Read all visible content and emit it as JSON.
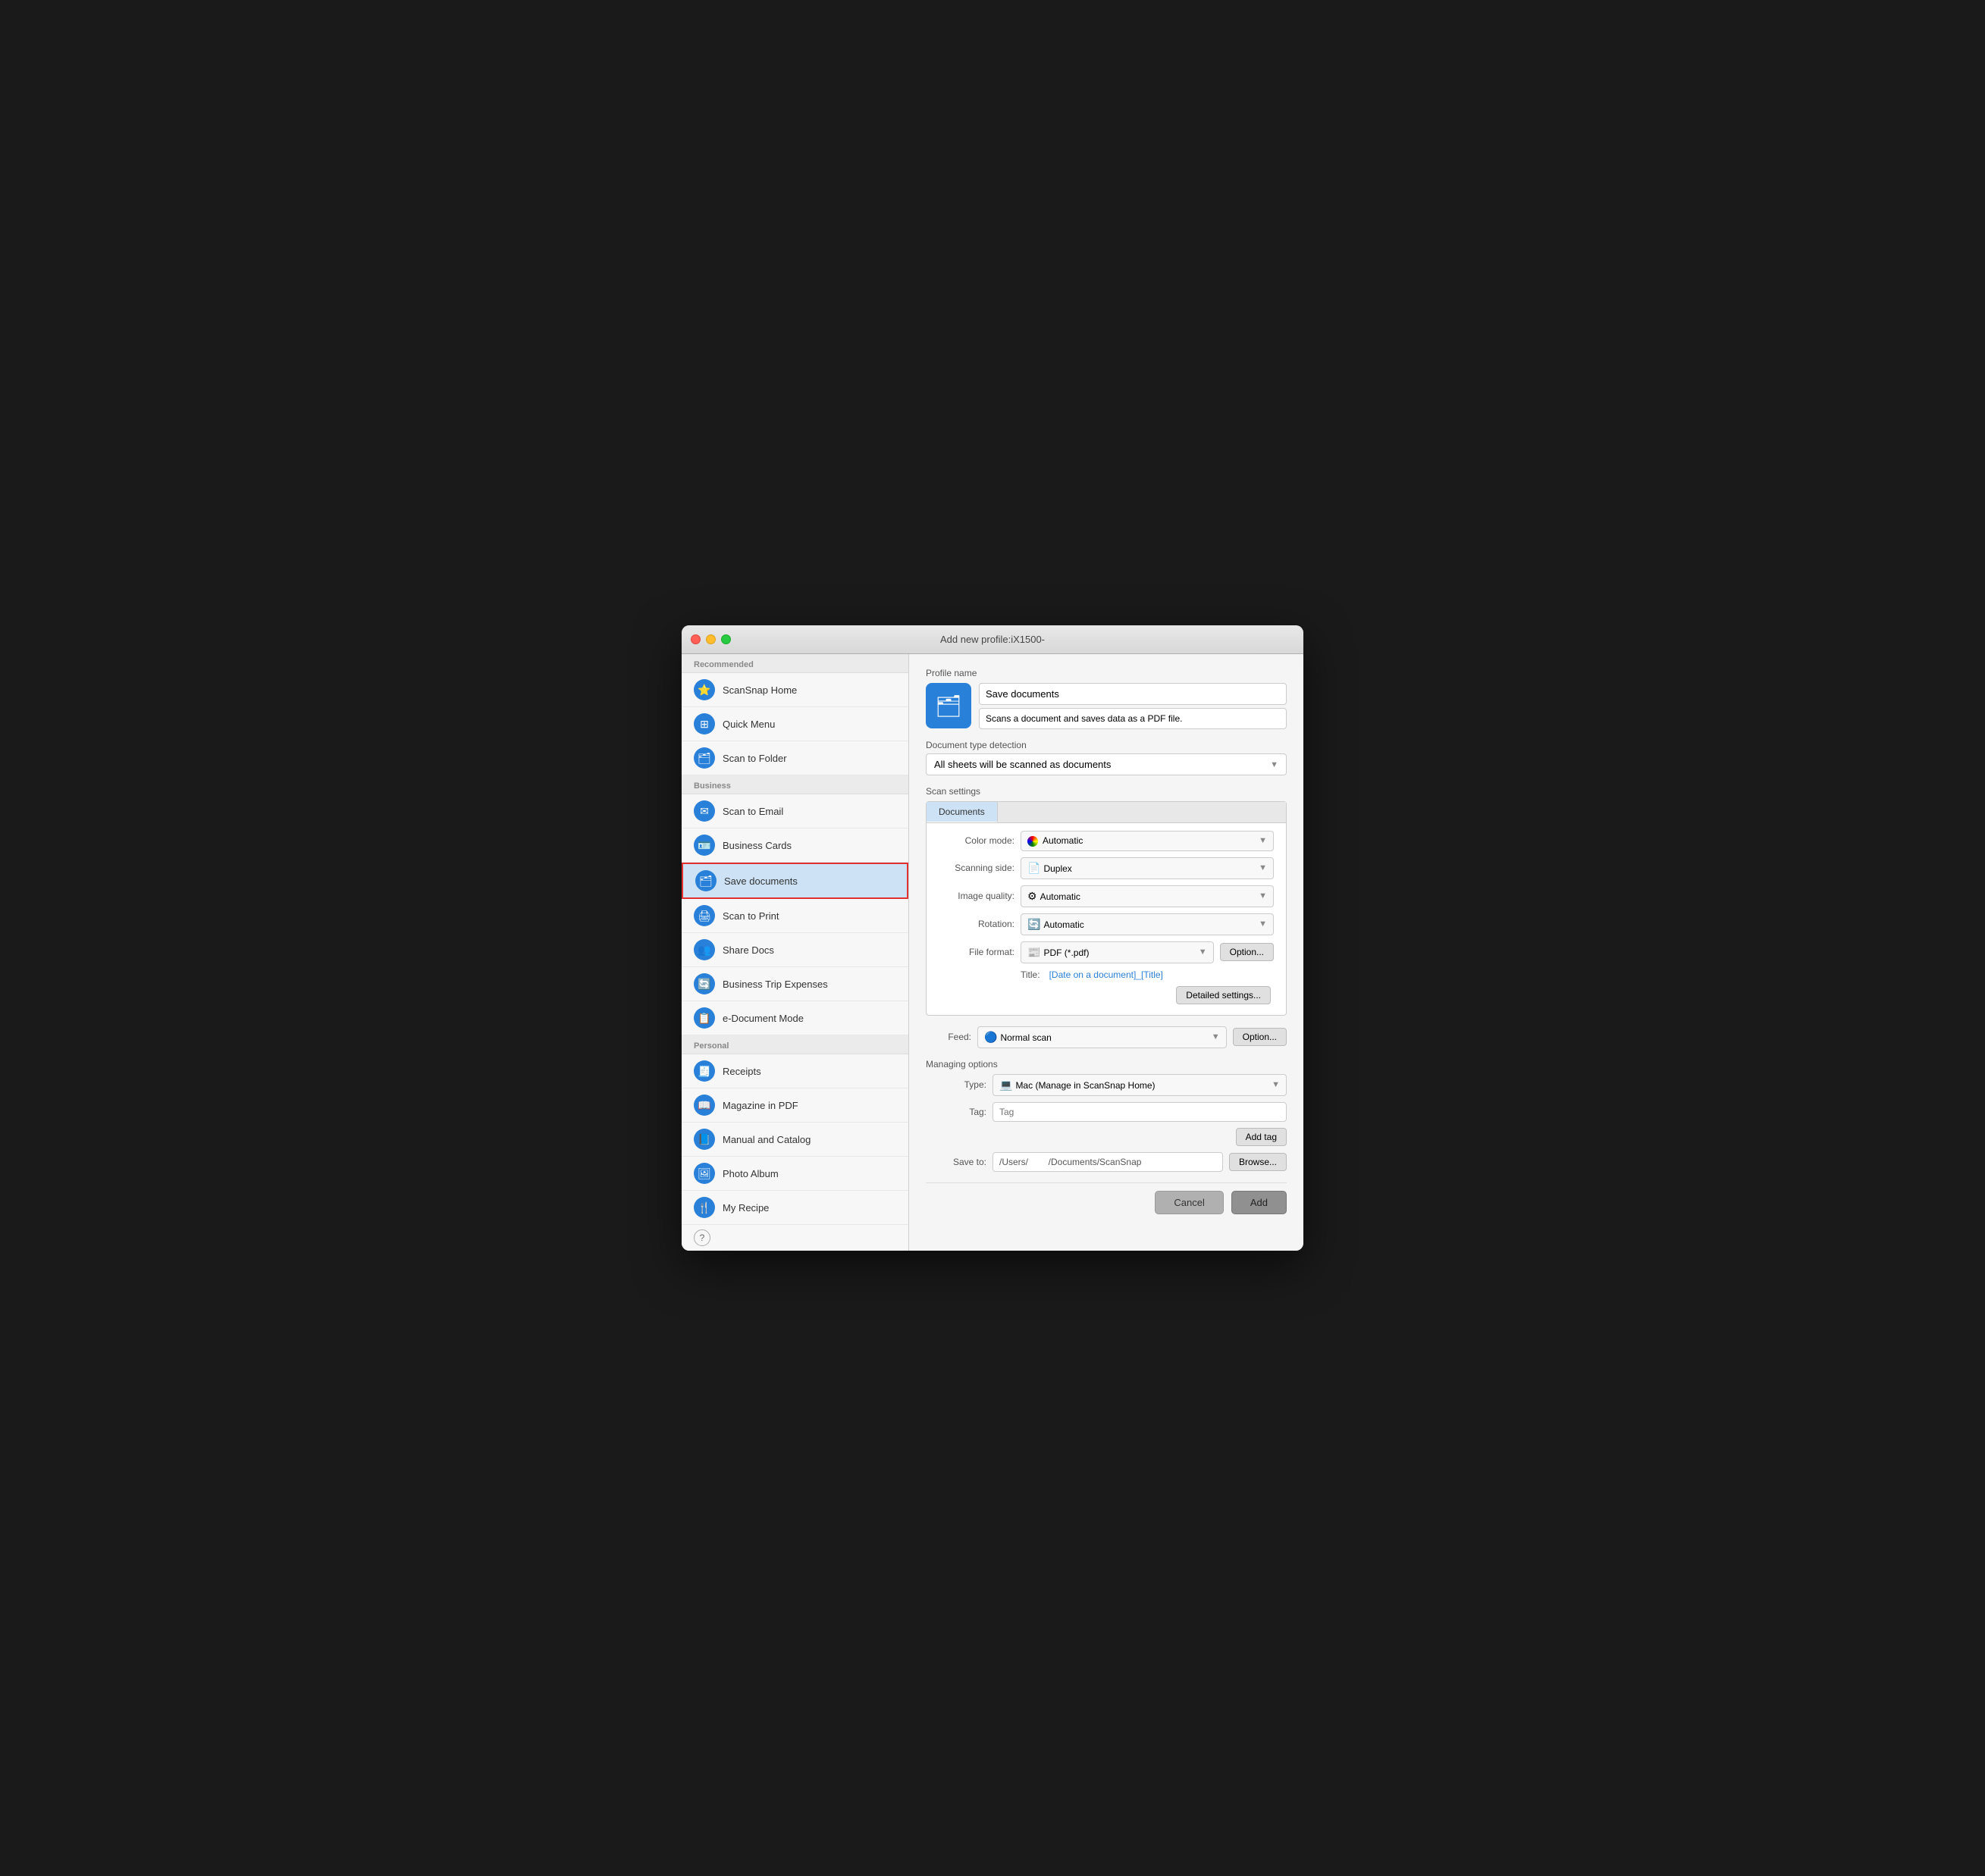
{
  "window": {
    "title": "Add new profile:iX1500-"
  },
  "sidebar": {
    "recommended_label": "Recommended",
    "business_label": "Business",
    "personal_label": "Personal",
    "recommended_items": [
      {
        "id": "scansnap-home",
        "label": "ScanSnap Home",
        "icon": "⭐"
      },
      {
        "id": "quick-menu",
        "label": "Quick Menu",
        "icon": "⊞"
      },
      {
        "id": "scan-to-folder",
        "label": "Scan to Folder",
        "icon": "🗂"
      }
    ],
    "business_items": [
      {
        "id": "scan-to-email",
        "label": "Scan to Email",
        "icon": "✉"
      },
      {
        "id": "business-cards",
        "label": "Business Cards",
        "icon": "🪪"
      },
      {
        "id": "save-documents",
        "label": "Save documents",
        "icon": "🗂",
        "selected": true
      },
      {
        "id": "scan-to-print",
        "label": "Scan to Print",
        "icon": "🖨"
      },
      {
        "id": "share-docs",
        "label": "Share Docs",
        "icon": "👥"
      },
      {
        "id": "business-trip",
        "label": "Business Trip Expenses",
        "icon": "🔄"
      },
      {
        "id": "e-document",
        "label": "e-Document Mode",
        "icon": "📋"
      }
    ],
    "personal_items": [
      {
        "id": "receipts",
        "label": "Receipts",
        "icon": "🧾"
      },
      {
        "id": "magazine",
        "label": "Magazine in PDF",
        "icon": "📖"
      },
      {
        "id": "manual",
        "label": "Manual and Catalog",
        "icon": "📘"
      },
      {
        "id": "photo-album",
        "label": "Photo Album",
        "icon": "🖼"
      },
      {
        "id": "my-recipe",
        "label": "My Recipe",
        "icon": "🍴"
      }
    ]
  },
  "right_panel": {
    "profile_name_label": "Profile name",
    "profile_name": "Save documents",
    "profile_desc": "Scans a document and saves data as a PDF file.",
    "detection_label": "Document type detection",
    "detection_value": "All sheets will be scanned as documents",
    "scan_settings_label": "Scan settings",
    "tab_documents": "Documents",
    "color_mode_label": "Color mode:",
    "color_mode_value": "Automatic",
    "scanning_side_label": "Scanning side:",
    "scanning_side_value": "Duplex",
    "image_quality_label": "Image quality:",
    "image_quality_value": "Automatic",
    "rotation_label": "Rotation:",
    "rotation_value": "Automatic",
    "file_format_label": "File format:",
    "file_format_value": "PDF (*.pdf)",
    "option_button": "Option...",
    "title_label": "Title:",
    "title_value": "[Date on a document]_[Title]",
    "detailed_settings": "Detailed settings...",
    "feed_label": "Feed:",
    "feed_value": "Normal scan",
    "feed_option": "Option...",
    "managing_options_label": "Managing options",
    "type_label": "Type:",
    "type_value": "Mac (Manage in ScanSnap Home)",
    "tag_label": "Tag:",
    "tag_placeholder": "Tag",
    "add_tag_button": "Add tag",
    "save_to_label": "Save to:",
    "save_to_value": "/Users/        /Documents/ScanSnap",
    "browse_button": "Browse...",
    "cancel_button": "Cancel",
    "add_button": "Add"
  }
}
